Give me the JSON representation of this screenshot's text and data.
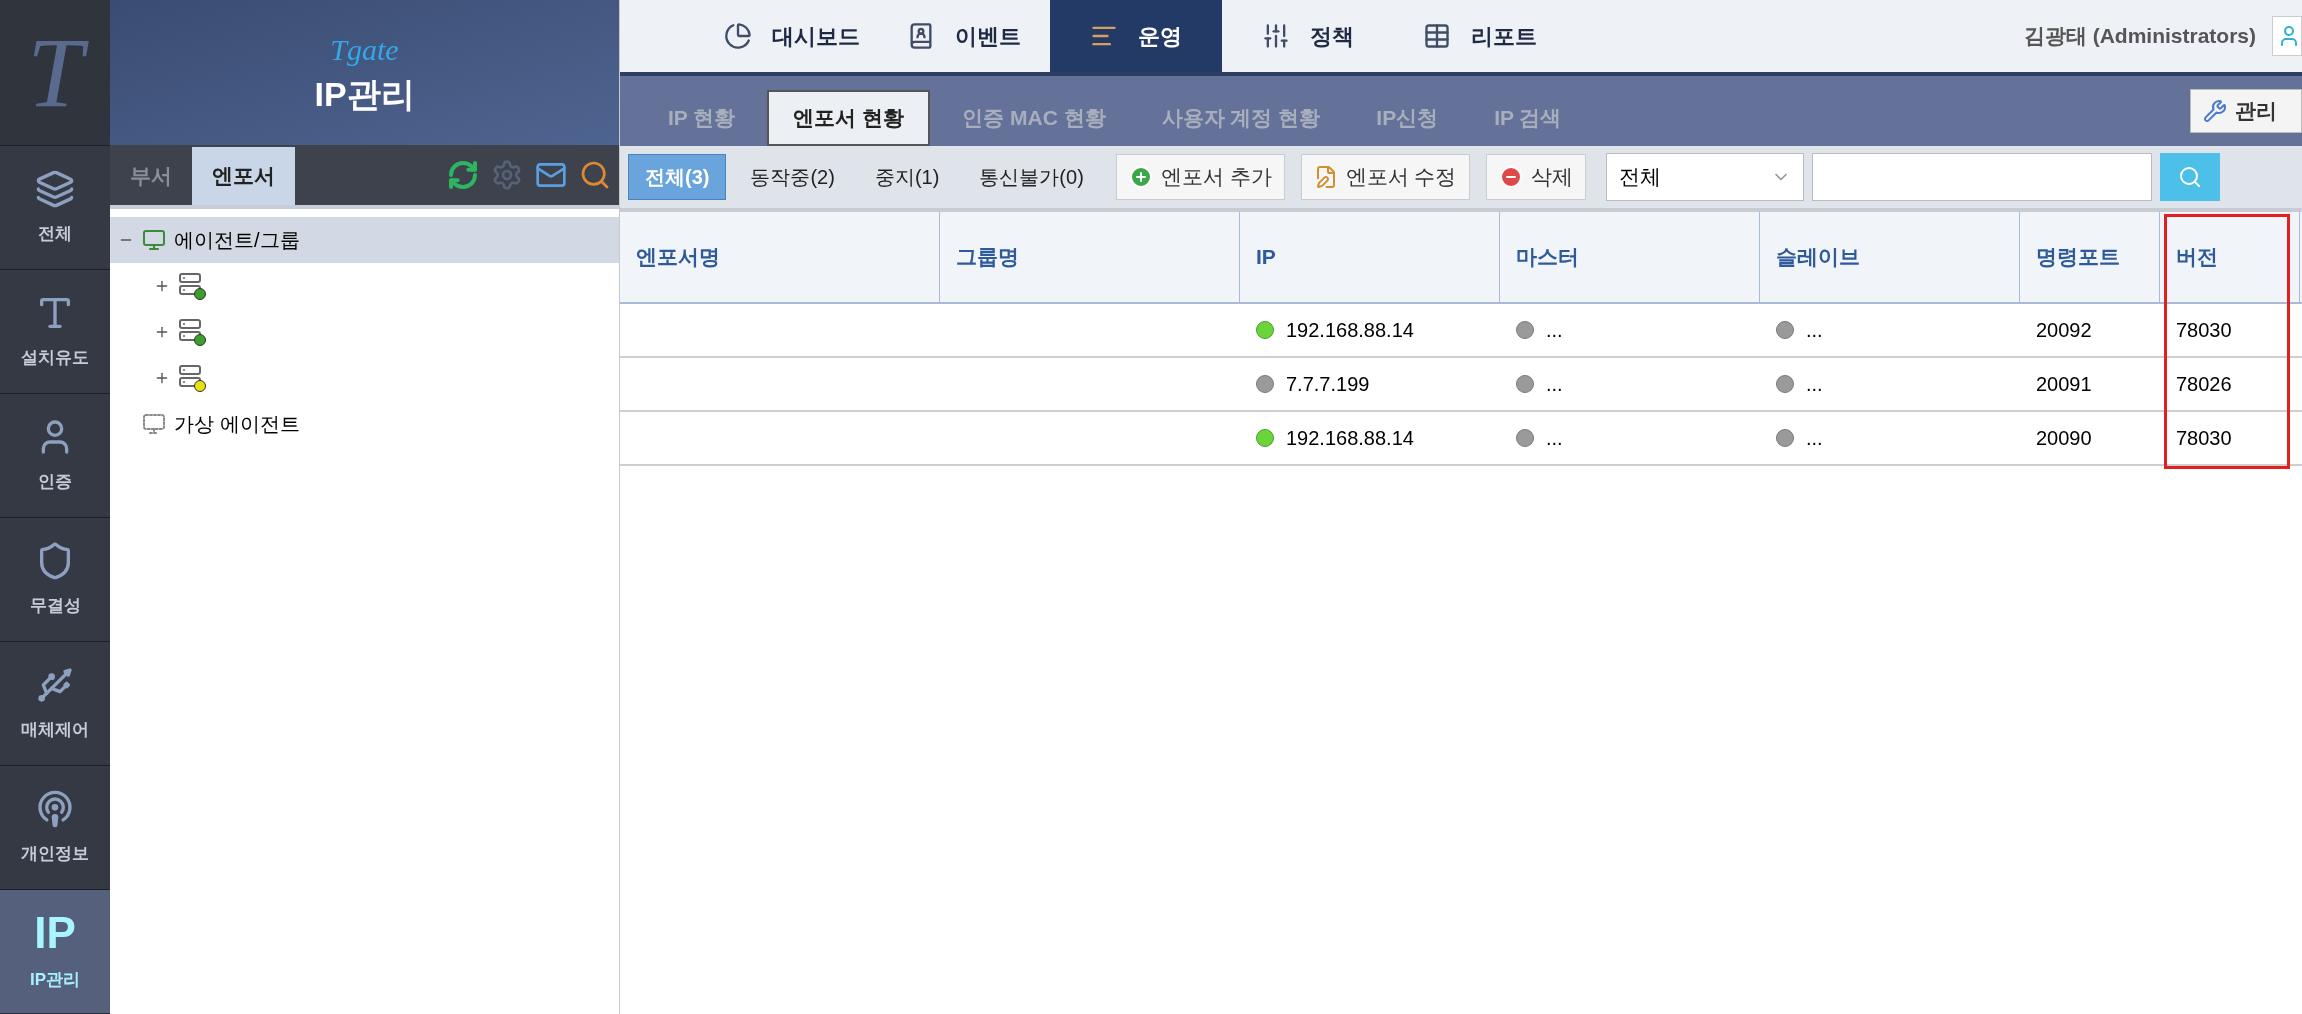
{
  "rail": {
    "logo": "T",
    "items": [
      {
        "label": "전체",
        "selected": false
      },
      {
        "label": "설치유도",
        "selected": false
      },
      {
        "label": "인증",
        "selected": false
      },
      {
        "label": "무결성",
        "selected": false
      },
      {
        "label": "매체제어",
        "selected": false
      },
      {
        "label": "개인정보",
        "selected": false
      },
      {
        "label": "IP관리",
        "icon_text": "IP",
        "selected": true
      }
    ]
  },
  "panel": {
    "logo": "Tgate",
    "title": "IP관리",
    "tabs": [
      {
        "label": "부서",
        "selected": false
      },
      {
        "label": "엔포서",
        "selected": true
      }
    ],
    "tree": [
      {
        "label": "에이전트/그룹",
        "kind": "agent",
        "expanded": true,
        "selected": true,
        "children": [
          {
            "kind": "enforcer",
            "running": true,
            "expanded": false
          },
          {
            "kind": "enforcer",
            "running": true,
            "expanded": false
          },
          {
            "kind": "enforcer",
            "running": false,
            "expanded": false
          }
        ]
      },
      {
        "label": "가상 에이전트",
        "kind": "virtual",
        "selected": false
      }
    ]
  },
  "top_nav": {
    "tabs": [
      {
        "label": "대시보드",
        "selected": false
      },
      {
        "label": "이벤트",
        "selected": false
      },
      {
        "label": "운영",
        "selected": true
      },
      {
        "label": "정책",
        "selected": false
      },
      {
        "label": "리포트",
        "selected": false
      }
    ],
    "user": "김광태 (Administrators)"
  },
  "sub_tabs": [
    {
      "label": "IP 현황",
      "selected": false
    },
    {
      "label": "엔포서 현황",
      "selected": true
    },
    {
      "label": "인증 MAC 현황",
      "selected": false
    },
    {
      "label": "사용자 계정 현황",
      "selected": false
    },
    {
      "label": "IP신청",
      "selected": false
    },
    {
      "label": "IP 검색",
      "selected": false
    }
  ],
  "admin_button": "관리",
  "filters": [
    {
      "label": "전체(3)",
      "selected": true
    },
    {
      "label": "동작중(2)",
      "selected": false
    },
    {
      "label": "중지(1)",
      "selected": false
    },
    {
      "label": "통신불가(0)",
      "selected": false
    }
  ],
  "actions": [
    {
      "label": "엔포서 추가",
      "kind": "add"
    },
    {
      "label": "엔포서 수정",
      "kind": "edit"
    },
    {
      "label": "삭제",
      "kind": "delete"
    }
  ],
  "search": {
    "scope": "전체"
  },
  "table": {
    "columns": [
      {
        "label": "엔포서명",
        "highlighted": false
      },
      {
        "label": "그룹명",
        "highlighted": false
      },
      {
        "label": "IP",
        "highlighted": false
      },
      {
        "label": "마스터",
        "highlighted": false
      },
      {
        "label": "슬레이브",
        "highlighted": false
      },
      {
        "label": "명령포트",
        "highlighted": false
      },
      {
        "label": "버전",
        "highlighted": true
      }
    ],
    "rows": [
      {
        "ip": "192.168.88.14",
        "ip_on": true,
        "master": "...",
        "master_on": false,
        "slave": "...",
        "slave_on": false,
        "port": "20092",
        "version": "78030"
      },
      {
        "ip": "7.7.7.199",
        "ip_on": false,
        "master": "...",
        "master_on": false,
        "slave": "...",
        "slave_on": false,
        "port": "20091",
        "version": "78026"
      },
      {
        "ip": "192.168.88.14",
        "ip_on": true,
        "master": "...",
        "master_on": false,
        "slave": "...",
        "slave_on": false,
        "port": "20090",
        "version": "78030"
      }
    ]
  }
}
